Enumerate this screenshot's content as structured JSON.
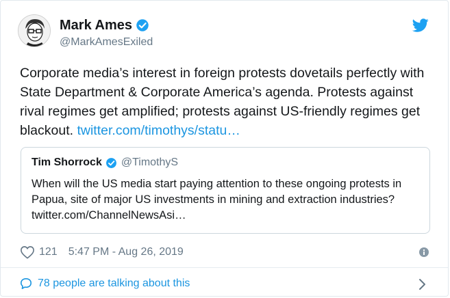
{
  "tweet": {
    "author_name": "Mark Ames",
    "author_handle": "@MarkAmesExiled",
    "text": "Corporate media’s interest in foreign protests dovetails perfectly with State Department & Corporate America’s agenda. Protests against rival regimes get amplified; protests against US-friendly regimes get blackout. ",
    "link": "twitter.com/timothys/statu…",
    "likes": "121",
    "timestamp": "5:47 PM - Aug 26, 2019",
    "talking": "78 people are talking about this"
  },
  "quote": {
    "author_name": "Tim Shorrock",
    "author_handle": "@TimothyS",
    "text": "When will the US media start paying attention to these ongoing protests in Papua, site of major US investments in mining and extraction industries? twitter.com/ChannelNewsAsi…"
  },
  "colors": {
    "brand": "#1da1f2",
    "link": "#1b95e0",
    "muted": "#657786",
    "border": "#e1e8ed"
  },
  "icons": [
    "avatar",
    "verified-badge-icon",
    "twitter-bird-icon",
    "heart-icon",
    "info-icon",
    "speech-bubble-icon",
    "chevron-right-icon"
  ]
}
